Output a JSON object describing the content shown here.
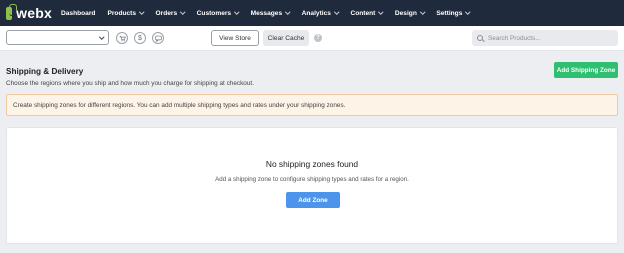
{
  "brand": {
    "name": "webx",
    "logo_color": "#8bc34a"
  },
  "nav": {
    "items": [
      {
        "label": "Dashboard",
        "has_dropdown": false
      },
      {
        "label": "Products",
        "has_dropdown": true
      },
      {
        "label": "Orders",
        "has_dropdown": true
      },
      {
        "label": "Customers",
        "has_dropdown": true
      },
      {
        "label": "Messages",
        "has_dropdown": true
      },
      {
        "label": "Analytics",
        "has_dropdown": true
      },
      {
        "label": "Content",
        "has_dropdown": true
      },
      {
        "label": "Design",
        "has_dropdown": true
      },
      {
        "label": "Settings",
        "has_dropdown": true
      }
    ],
    "background": "#1f2a3c"
  },
  "toolbar": {
    "store_select_value": "",
    "icons": [
      "cart-icon",
      "dollar-icon",
      "chat-icon"
    ],
    "view_store_label": "View Store",
    "clear_cache_label": "Clear Cache",
    "help_icon": "?",
    "search_placeholder": "Search Products..."
  },
  "page": {
    "title": "Shipping & Delivery",
    "subtitle": "Choose the regions where you ship and how much you charge for shipping at checkout.",
    "add_zone_button": "Add Shipping Zone",
    "add_zone_button_color": "#2fbf71"
  },
  "notice": {
    "text": "Create shipping zones for different regions. You can add multiple shipping types and rates under your shipping zones."
  },
  "empty_state": {
    "title": "No shipping zones found",
    "text": "Add a shipping zone to configure shipping types and rates for a region.",
    "button": "Add Zone",
    "button_color": "#4d95ea"
  }
}
